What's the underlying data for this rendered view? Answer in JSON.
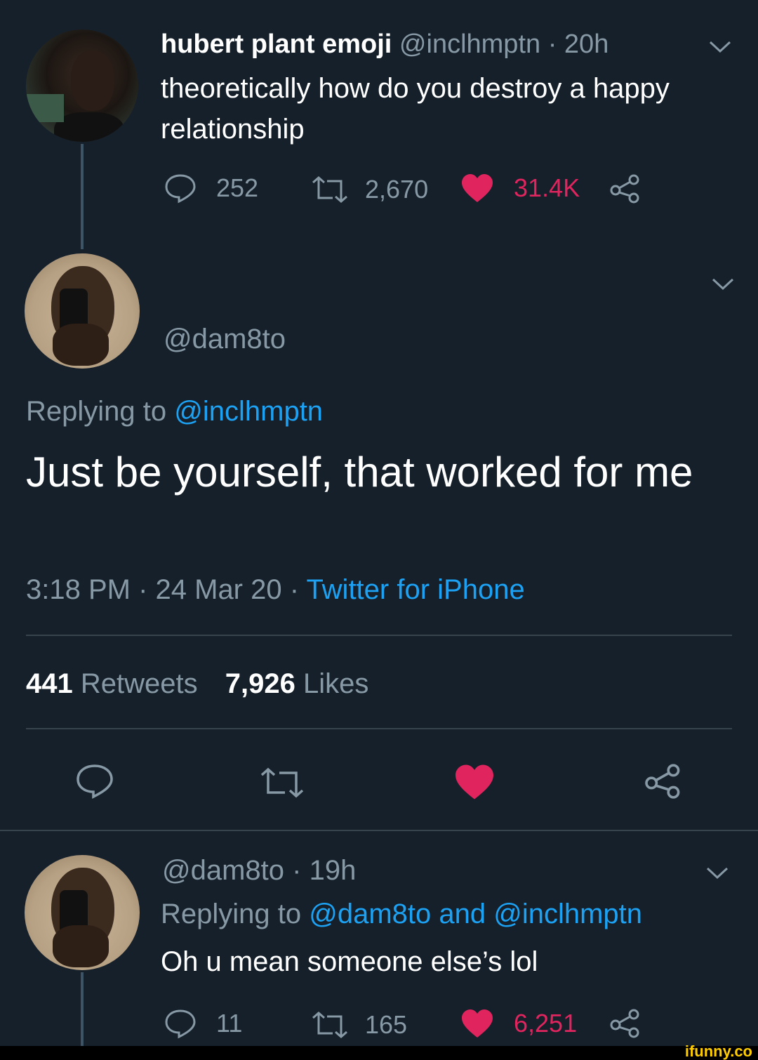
{
  "tweet1": {
    "display_name": "hubert plant emoji",
    "handle": "@inclhmptn",
    "separator": "·",
    "time": "20h",
    "text": "theoretically how do you destroy a happy relationship",
    "replies": "252",
    "retweets": "2,670",
    "likes": "31.4K"
  },
  "main_tweet": {
    "handle": "@dam8to",
    "replying_prefix": "Replying to",
    "replying_handle": "@inclhmptn",
    "text": "Just be yourself, that worked for me",
    "timestamp": "3:18 PM · 24 Mar 20 ·",
    "source": "Twitter for iPhone",
    "retweets_count": "441",
    "retweets_label": "Retweets",
    "likes_count": "7,926",
    "likes_label": "Likes"
  },
  "tweet3": {
    "handle": "@dam8to",
    "separator": "·",
    "time": "19h",
    "replying_prefix": "Replying to",
    "replying_handles": "@dam8to and @inclhmptn",
    "text": "Oh u mean someone else’s lol",
    "replies": "11",
    "retweets": "165",
    "likes": "6,251"
  },
  "watermark": "ifunny.co",
  "colors": {
    "background": "#15202b",
    "muted": "#8899a6",
    "link": "#1da1f2",
    "like": "#e0245e",
    "watermark": "#ffcc00"
  },
  "icons": [
    "reply-icon",
    "retweet-icon",
    "heart-icon",
    "share-icon",
    "chevron-down-icon"
  ]
}
